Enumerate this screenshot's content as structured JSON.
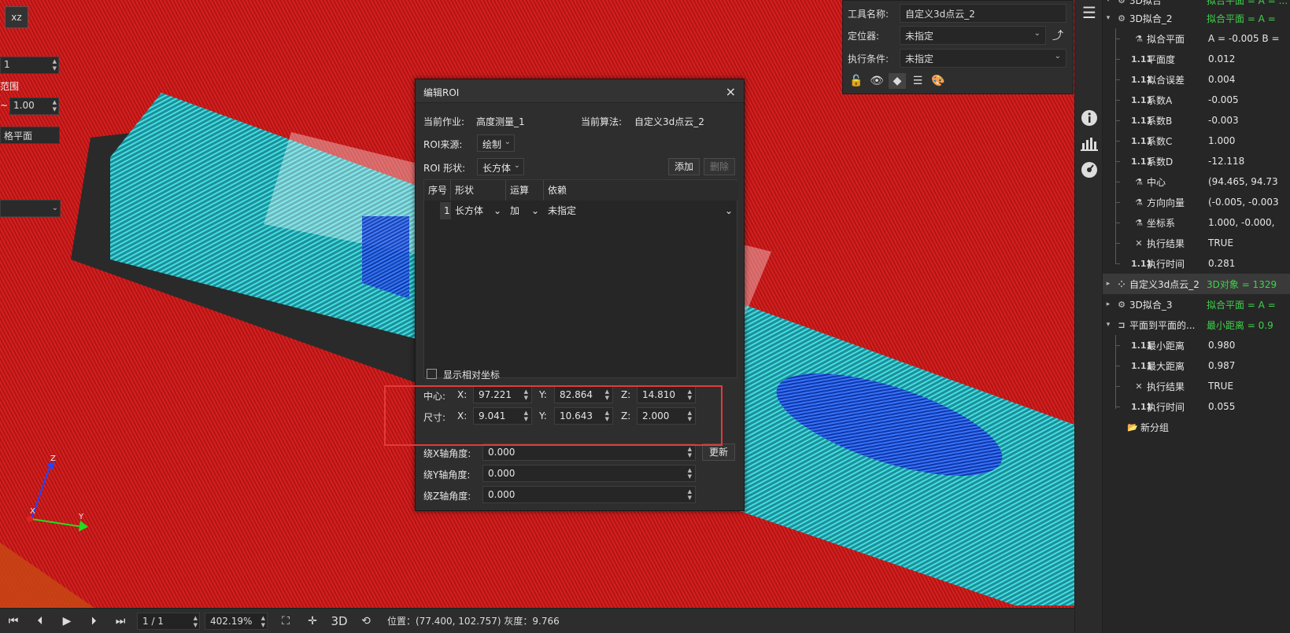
{
  "viewport": {
    "view_button": "xz",
    "left_input_1": "1",
    "range_label": "范围",
    "range_sep": "~",
    "range_max": "1.00",
    "plane_label": "格平面",
    "axis_z": "Z",
    "axis_x": "X",
    "axis_y": "Y"
  },
  "bottombar": {
    "frame": "1 / 1",
    "zoom": "402.19%",
    "mode_3d": "3D",
    "position_label": "位置：(77.400, 102.757) 灰度：9.766"
  },
  "prop_panel": {
    "tool_name_label": "工具名称:",
    "tool_name_value": "自定义3d点云_2",
    "locator_label": "定位器:",
    "locator_value": "未指定",
    "exec_cond_label": "执行条件:",
    "exec_cond_value": "未指定"
  },
  "dialog": {
    "title": "编辑ROI",
    "close": "×",
    "current_job_label": "当前作业:",
    "current_job_value": "高度测量_1",
    "current_algo_label": "当前算法:",
    "current_algo_value": "自定义3d点云_2",
    "roi_source_label": "ROI来源:",
    "roi_source_value": "绘制",
    "roi_shape_label": "ROI 形状:",
    "roi_shape_value": "长方体",
    "add_button": "添加",
    "delete_button": "删除",
    "table": {
      "headers": [
        "序号",
        "形状",
        "运算",
        "依赖"
      ],
      "rows": [
        {
          "index": "1",
          "shape": "长方体",
          "op": "加",
          "dep": "未指定"
        }
      ]
    },
    "show_relative_label": "显示相对坐标",
    "center_label": "中心:",
    "size_label": "尺寸:",
    "x_label": "X:",
    "y_label": "Y:",
    "z_label": "Z:",
    "center_x": "97.221",
    "center_y": "82.864",
    "center_z": "14.810",
    "size_x": "9.041",
    "size_y": "10.643",
    "size_z": "2.000",
    "rot_x_label": "绕X轴角度:",
    "rot_x": "0.000",
    "rot_y_label": "绕Y轴角度:",
    "rot_y": "0.000",
    "rot_z_label": "绕Z轴角度:",
    "rot_z": "0.000",
    "update_button": "更新"
  },
  "tree": {
    "top_partial_name": "3D拟合",
    "top_partial_val": "拟合平面 = A = ...",
    "items": [
      {
        "name": "3D拟合_2",
        "val": "拟合平面 = A =",
        "green": true
      },
      {
        "name": "拟合平面",
        "val": "A = -0.005 B ="
      },
      {
        "name": "平面度",
        "val": "0.012"
      },
      {
        "name": "拟合误差",
        "val": "0.004"
      },
      {
        "name": "系数A",
        "val": "-0.005"
      },
      {
        "name": "系数B",
        "val": "-0.003"
      },
      {
        "name": "系数C",
        "val": "1.000"
      },
      {
        "name": "系数D",
        "val": "-12.118"
      },
      {
        "name": "中心",
        "val": "(94.465, 94.73"
      },
      {
        "name": "方向向量",
        "val": "(-0.005, -0.003"
      },
      {
        "name": "坐标系",
        "val": "1.000, -0.000,"
      },
      {
        "name": "执行结果",
        "val": "TRUE"
      },
      {
        "name": "执行时间",
        "val": "0.281"
      },
      {
        "name": "自定义3d点云_2",
        "val": "3D对象 = 1329",
        "green": true
      },
      {
        "name": "3D拟合_3",
        "val": "拟合平面 = A =",
        "green": true
      },
      {
        "name": "平面到平面的...",
        "val": "最小距离 = 0.9",
        "green": true
      },
      {
        "name": "最小距离",
        "val": "0.980"
      },
      {
        "name": "最大距离",
        "val": "0.987"
      },
      {
        "name": "执行结果",
        "val": "TRUE"
      },
      {
        "name": "执行时间",
        "val": "0.055"
      },
      {
        "name": "新分组",
        "val": ""
      }
    ]
  },
  "colors": {
    "background_red": "#c81a1a",
    "cloud_cyan": "#35d6d6",
    "highlight_red": "#e33a3a",
    "tree_green": "#3fd14b"
  }
}
